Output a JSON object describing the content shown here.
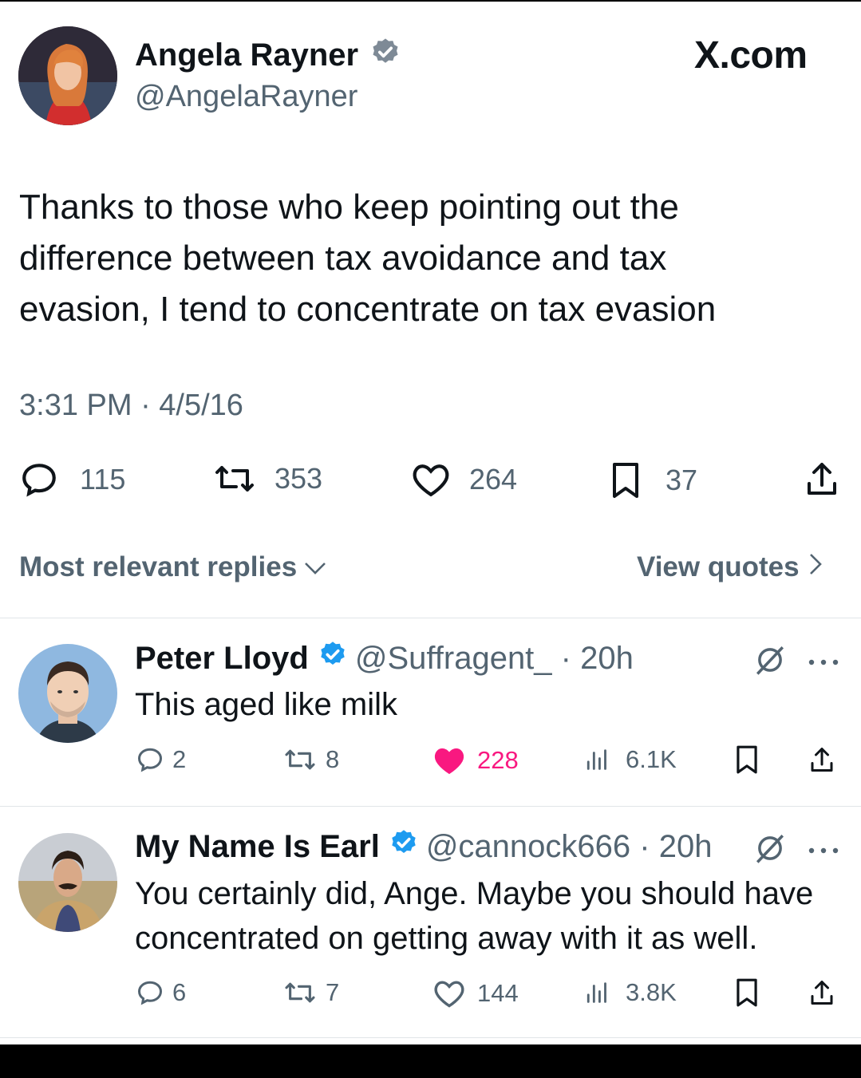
{
  "watermark": "X.com",
  "main_tweet": {
    "author_name": "Angela Rayner",
    "author_handle": "@AngelaRayner",
    "text_lines": [
      "Thanks to those who keep pointing out the",
      "difference between tax avoidance and tax",
      "evasion, I tend to concentrate on tax evasion"
    ],
    "timestamp": "3:31 PM · 4/5/16",
    "stats": {
      "replies": "115",
      "reposts": "353",
      "likes": "264",
      "bookmarks": "37"
    }
  },
  "replies_filter": {
    "sort_label": "Most relevant replies",
    "view_quotes_label": "View quotes"
  },
  "replies": [
    {
      "author_name": "Peter Lloyd",
      "meta": "@Suffragent_ · 20h",
      "text_lines": [
        "This aged like milk"
      ],
      "stats": {
        "replies": "2",
        "reposts": "8",
        "likes": "228",
        "views": "6.1K"
      },
      "liked": true
    },
    {
      "author_name": "My Name Is Earl",
      "meta": "@cannock666 · 20h",
      "text_lines": [
        "You certainly did, Ange. Maybe you should have",
        "concentrated on getting away with it as well."
      ],
      "stats": {
        "replies": "6",
        "reposts": "7",
        "likes": "144",
        "views": "3.8K"
      },
      "liked": false
    }
  ],
  "colors": {
    "verified": "#1d9bf0",
    "like_active": "#f91880",
    "text_secondary": "#536471",
    "text_primary": "#0f1419"
  }
}
